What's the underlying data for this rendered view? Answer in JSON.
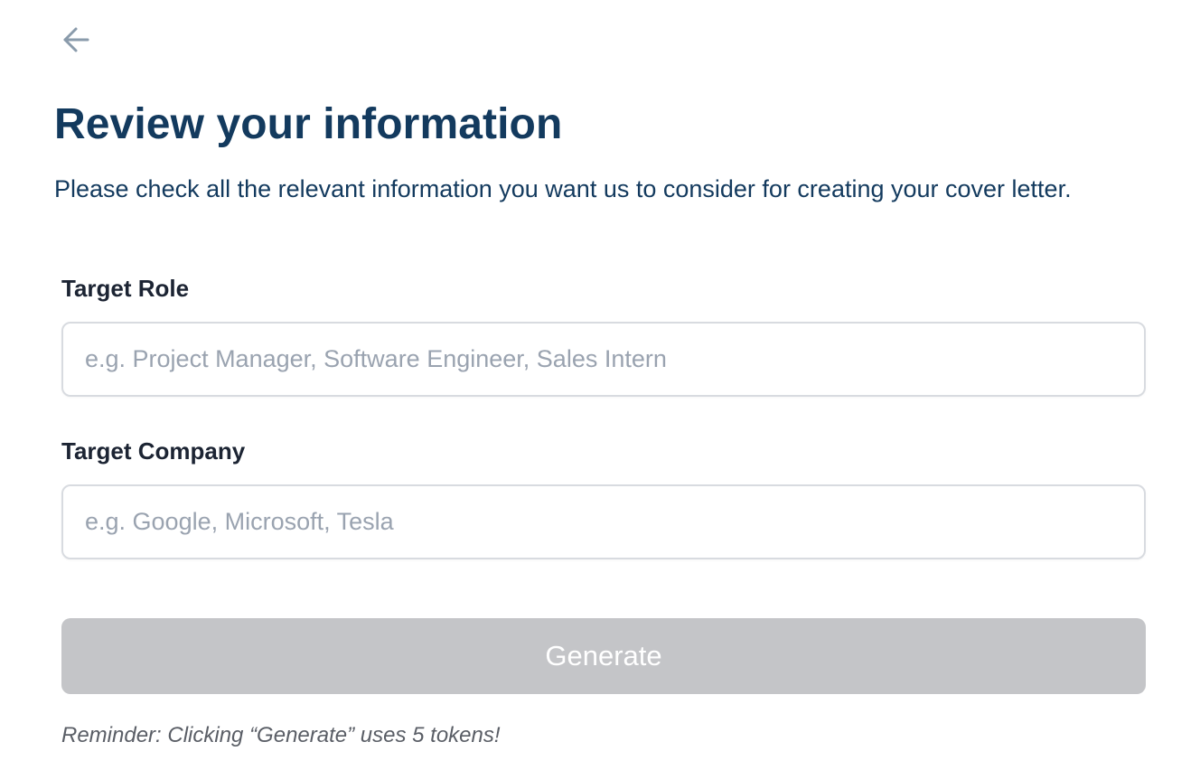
{
  "header": {
    "back_icon": "arrow-left-icon",
    "title": "Review your information",
    "subtitle": "Please check all the relevant information you want us to consider for creating your cover letter."
  },
  "form": {
    "target_role": {
      "label": "Target Role",
      "value": "",
      "placeholder": "e.g. Project Manager, Software Engineer, Sales Intern"
    },
    "target_company": {
      "label": "Target Company",
      "value": "",
      "placeholder": "e.g. Google, Microsoft, Tesla"
    },
    "generate_label": "Generate",
    "reminder": "Reminder: Clicking “Generate” uses 5 tokens!"
  },
  "colors": {
    "title": "#133a5e",
    "label": "#1c2433",
    "placeholder": "#9aa3b0",
    "button_disabled": "#c4c5c8",
    "icon": "#8a9bab"
  }
}
